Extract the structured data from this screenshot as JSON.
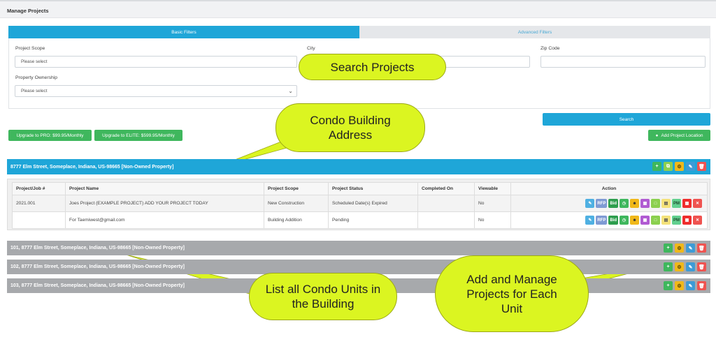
{
  "page": {
    "title": "Manage Projects"
  },
  "tabs": {
    "basic": "Basic Filters",
    "advanced": "Advanced Filters"
  },
  "filters": {
    "project_scope": {
      "label": "Project Scope",
      "placeholder": "Please select"
    },
    "city": {
      "label": "City"
    },
    "zip": {
      "label": "Zip Code"
    },
    "ownership": {
      "label": "Property Ownership",
      "placeholder": "Please select"
    }
  },
  "buttons": {
    "search": "Search",
    "upgrade_pro": "Upgrade to PRO: $99.95/Monthly",
    "upgrade_elite": "Upgrade to ELITE: $599.95/Monthly",
    "add_location": "Add Project Location"
  },
  "building": {
    "title": "8777 Elm Street, Someplace, Indiana, US-98665 [Non-Owned Property]"
  },
  "table": {
    "headers": [
      "Project/Job #",
      "Project Name",
      "Project Scope",
      "Project Status",
      "Completed On",
      "Viewable",
      "Action"
    ],
    "rows": [
      {
        "job": "2021.001",
        "name": "Joes Project (EXAMPLE PROJECT) ADD YOUR PROJECT TODAY",
        "scope": "New Construction",
        "status": "Scheduled Date(s) Expired",
        "completed": "",
        "viewable": "No"
      },
      {
        "job": "",
        "name": "For Taemiwest@gmail.com",
        "scope": "Building Addition",
        "status": "Pending",
        "completed": "",
        "viewable": "No"
      }
    ],
    "action_labels": {
      "rfp": "RFP",
      "bid": "Bid",
      "pm": "PM"
    }
  },
  "units": [
    {
      "title": "101, 8777 Elm Street, Someplace, Indiana, US-98665 [Non-Owned Property]"
    },
    {
      "title": "102, 8777 Elm Street, Someplace, Indiana, US-98665 [Non-Owned Property]"
    },
    {
      "title": "103, 8777 Elm Street, Someplace, Indiana, US-98665 [Non-Owned Property]"
    }
  ],
  "callouts": {
    "search": "Search Projects",
    "building": "Condo Building Address",
    "units": "List all Condo Units in the Building",
    "manage": "Add and Manage Projects for Each Unit"
  },
  "colors": {
    "primary": "#1fa6d8",
    "success": "#3fb75d",
    "gray_bar": "#a7a9ac",
    "callout": "#dbf521"
  }
}
